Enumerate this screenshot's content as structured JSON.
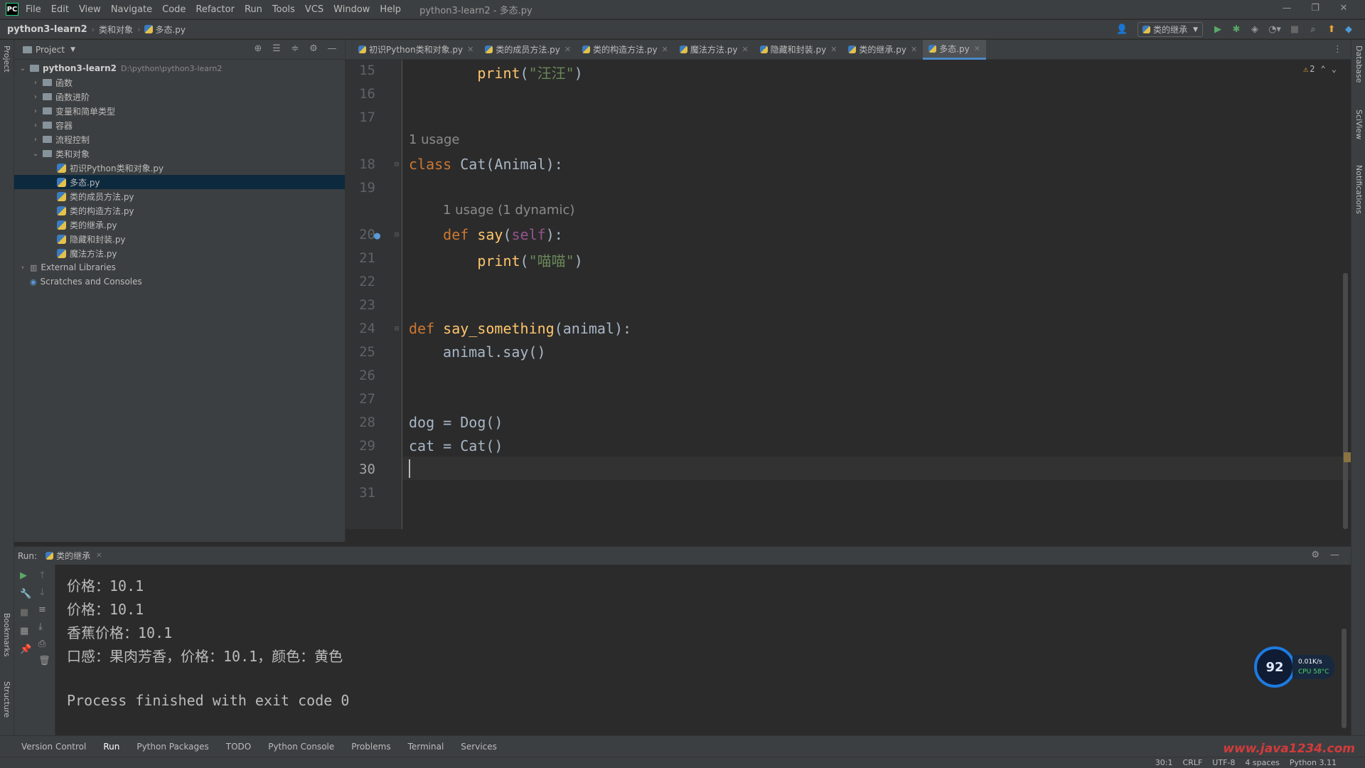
{
  "window": {
    "app_logo": "PC",
    "menu": [
      "File",
      "Edit",
      "View",
      "Navigate",
      "Code",
      "Refactor",
      "Run",
      "Tools",
      "VCS",
      "Window",
      "Help"
    ],
    "title": "python3-learn2 - 多态.py"
  },
  "navbar": {
    "breadcrumb": [
      "python3-learn2",
      "类和对象",
      "多态.py"
    ],
    "run_config": "类的继承"
  },
  "project": {
    "header": "Project",
    "root_name": "python3-learn2",
    "root_path": "D:\\python\\python3-learn2",
    "folders": [
      "函数",
      "函数进阶",
      "变量和简单类型",
      "容器",
      "流程控制"
    ],
    "open_folder": "类和对象",
    "files": [
      "初识Python类和对象.py",
      "多态.py",
      "类的成员方法.py",
      "类的构造方法.py",
      "类的继承.py",
      "隐藏和封装.py",
      "魔法方法.py"
    ],
    "selected_file": "多态.py",
    "external": "External Libraries",
    "scratches": "Scratches and Consoles"
  },
  "tabs": [
    "初识Python类和对象.py",
    "类的成员方法.py",
    "类的构造方法.py",
    "魔法方法.py",
    "隐藏和封装.py",
    "类的继承.py",
    "多态.py"
  ],
  "active_tab": "多态.py",
  "editor": {
    "warning_count": "2",
    "line_numbers": [
      "15",
      "16",
      "17",
      "18",
      "19",
      "20",
      "21",
      "22",
      "23",
      "24",
      "25",
      "26",
      "27",
      "28",
      "29",
      "30",
      "31"
    ],
    "hint_1": "1 usage",
    "hint_2": "1 usage (1 dynamic)",
    "code": {
      "l15_fn": "print",
      "l15_str": "\"汪汪\"",
      "l18_kw": "class",
      "l18_rest": " Cat(Animal):",
      "l20_kw": "def",
      "l20_fn": "say",
      "l20_self": "self",
      "l21_fn": "print",
      "l21_str": "\"喵喵\"",
      "l24_kw": "def",
      "l24_fn": "say_something",
      "l24_rest": "(animal):",
      "l25": "animal.say()",
      "l28": "dog = Dog()",
      "l29": "cat = Cat()"
    }
  },
  "run": {
    "label": "Run:",
    "tab": "类的继承",
    "output": [
      "价格：10.1",
      "价格：10.1",
      "香蕉价格：10.1",
      "口感：果肉芳香，价格：10.1，颜色：黄色",
      "",
      "Process finished with exit code 0"
    ]
  },
  "widget": {
    "percent": "92",
    "net": "0.01K/s",
    "cpu": "CPU 58°C"
  },
  "toolwindows": [
    "Version Control",
    "Run",
    "Python Packages",
    "TODO",
    "Python Console",
    "Problems",
    "Terminal",
    "Services"
  ],
  "right_strip": [
    "Database",
    "SciView",
    "Notifications"
  ],
  "left_strip": [
    "Project",
    "Bookmarks",
    "Structure"
  ],
  "status": {
    "position": "30:1",
    "line_sep": "CRLF",
    "encoding": "UTF-8",
    "indent": "4 spaces",
    "interpreter": "Python 3.11"
  },
  "watermark": "www.java1234.com"
}
